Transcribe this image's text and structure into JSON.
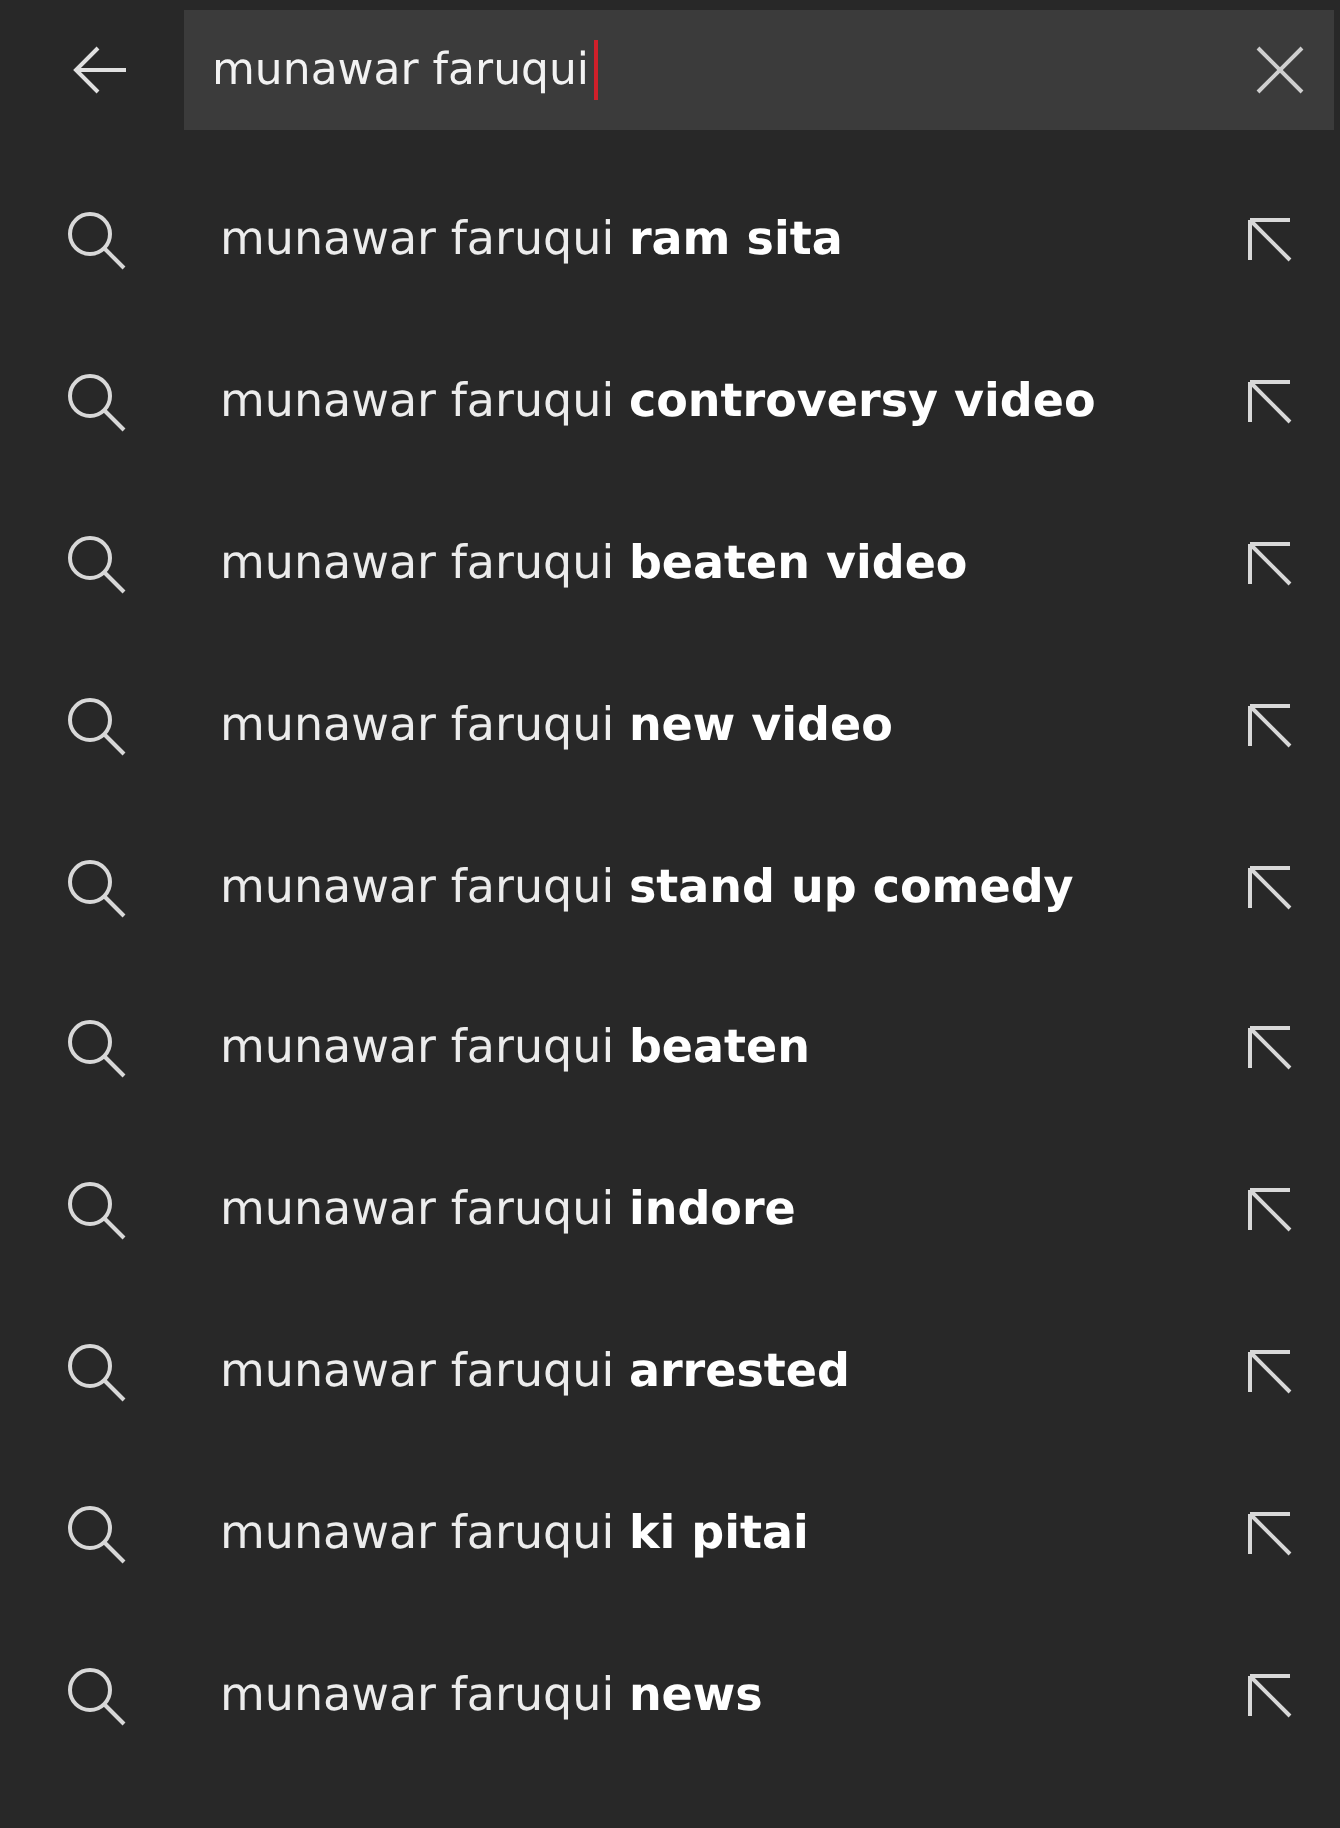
{
  "search": {
    "value": "munawar faruqui"
  },
  "suggestions": [
    {
      "text": "munawar faruqui **ram sita**"
    },
    {
      "text": "munawar faruqui **controversy video**"
    },
    {
      "text": "munawar faruqui **beaten video**"
    },
    {
      "text": "munawar faruqui **new video**"
    },
    {
      "text": "munawar faruqui **stand up comedy**"
    },
    {
      "text": "munawar faruqui **beaten**"
    },
    {
      "text": "munawar faruqui **indore**"
    },
    {
      "text": "munawar faruqui **arrested**"
    },
    {
      "text": "munawar faruqui **ki pitai**"
    },
    {
      "text": "munawar faruqui **news**"
    }
  ]
}
